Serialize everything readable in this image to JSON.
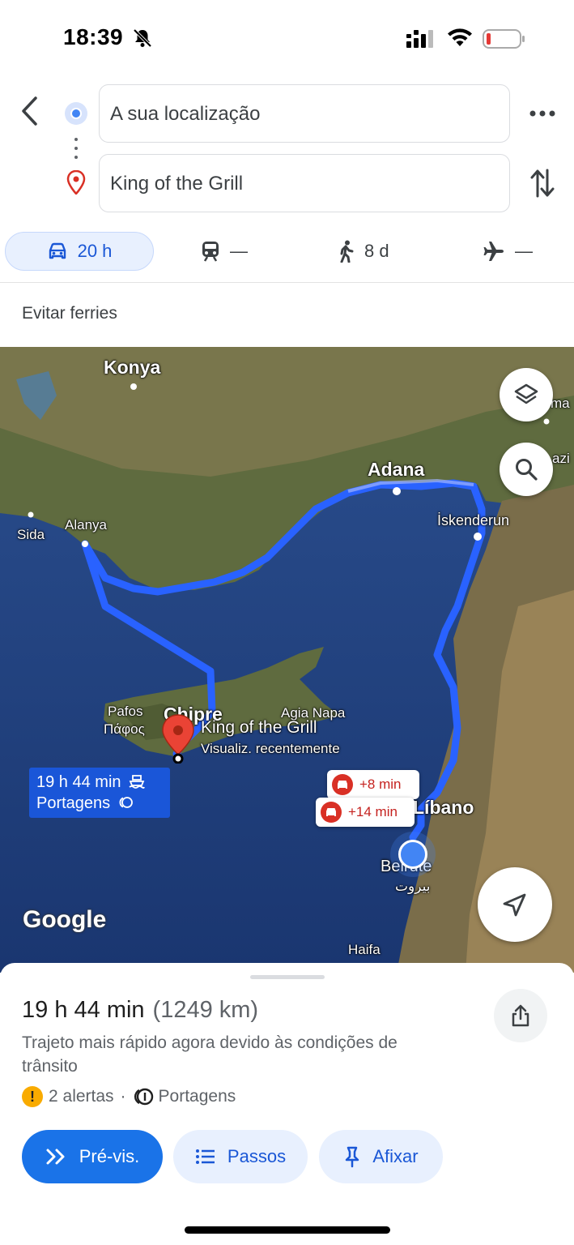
{
  "status_bar": {
    "time": "18:39",
    "icons": [
      "bell-off-icon",
      "signal-icon",
      "wifi-icon",
      "battery-low-icon"
    ]
  },
  "directions": {
    "origin": "A sua localização",
    "destination": "King of the Grill"
  },
  "modes": [
    {
      "name": "car",
      "value": "20 h",
      "selected": true
    },
    {
      "name": "transit",
      "value": "—"
    },
    {
      "name": "walk",
      "value": "8 d"
    },
    {
      "name": "flight",
      "value": "—"
    }
  ],
  "options": {
    "avoid_ferries": "Evitar ferries"
  },
  "map": {
    "labels": {
      "konya": "Konya",
      "adana": "Adana",
      "iskenderun": "İskenderun",
      "alanya": "Alanya",
      "sida": "Sida",
      "pafos": "Pafos",
      "pafos_greek": "Πάφος",
      "chipre": "Chipre",
      "agia_napa": "Agia Napa",
      "libano": "Líbano",
      "beirute": "Beirute",
      "beirute_arabic": "بيروت",
      "haifa": "Haifa",
      "edge_right_1": "ma",
      "edge_right_2": "azi"
    },
    "place_name": "King of the Grill",
    "place_sub": "Visualiz. recentemente",
    "route_callout": {
      "time": "19 h 44 min",
      "tolls": "Portagens"
    },
    "traffic_badges": [
      "+8 min",
      "+14 min"
    ],
    "logo": "Google",
    "colors": {
      "route": "#2962ff",
      "water": "#1f3f7a",
      "land": "#6e6a4a"
    }
  },
  "sheet": {
    "duration": "19 h 44 min",
    "distance": "(1249 km)",
    "description": "Trajeto mais rápido agora devido às condições de trânsito",
    "alerts": "2 alertas",
    "separator": "·",
    "tolls": "Portagens",
    "buttons": {
      "preview": "Pré-vis.",
      "steps": "Passos",
      "pin": "Afixar"
    }
  }
}
